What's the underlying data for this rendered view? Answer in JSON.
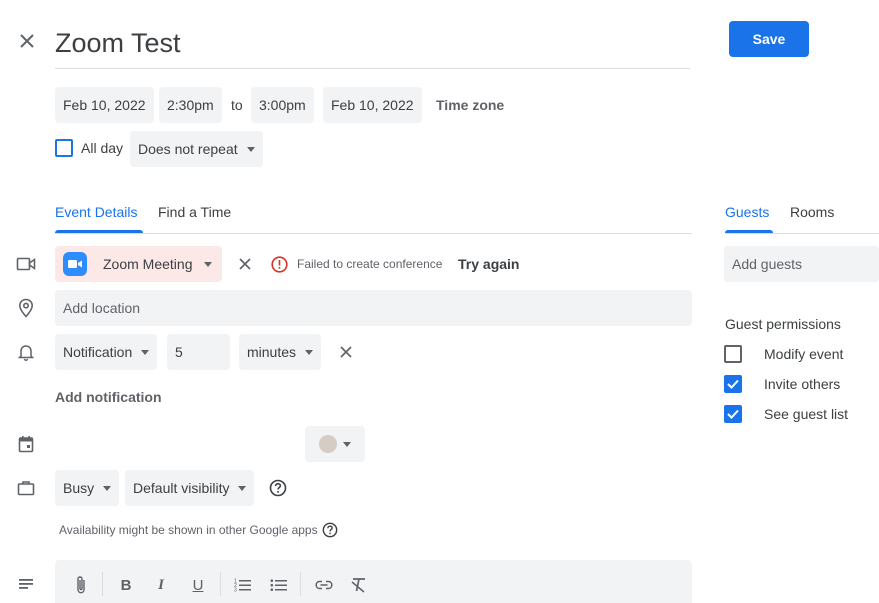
{
  "event": {
    "title": "Zoom Test",
    "save_label": "Save"
  },
  "datetime": {
    "start_date": "Feb 10, 2022",
    "start_time": "2:30pm",
    "to_label": "to",
    "end_time": "3:00pm",
    "end_date": "Feb 10, 2022",
    "timezone_label": "Time zone",
    "all_day_label": "All day",
    "all_day_checked": false,
    "repeat": "Does not repeat"
  },
  "tabs": {
    "details": "Event Details",
    "find_time": "Find a Time",
    "guests": "Guests",
    "rooms": "Rooms"
  },
  "conference": {
    "label": "Zoom Meeting",
    "error": "Failed to create conference",
    "retry": "Try again"
  },
  "location": {
    "placeholder": "Add location"
  },
  "notification": {
    "type": "Notification",
    "amount": "5",
    "unit": "minutes",
    "add_label": "Add notification"
  },
  "availability": {
    "status": "Busy",
    "visibility": "Default visibility",
    "note": "Availability might be shown in other Google apps"
  },
  "guests": {
    "placeholder": "Add guests",
    "permissions_title": "Guest permissions",
    "permissions": [
      {
        "label": "Modify event",
        "checked": false
      },
      {
        "label": "Invite others",
        "checked": true
      },
      {
        "label": "See guest list",
        "checked": true
      }
    ]
  },
  "colors": {
    "accent": "#1a73e8",
    "event_color": "#d5ccc4",
    "error": "#d93025",
    "zoom": "#2d8cff"
  }
}
